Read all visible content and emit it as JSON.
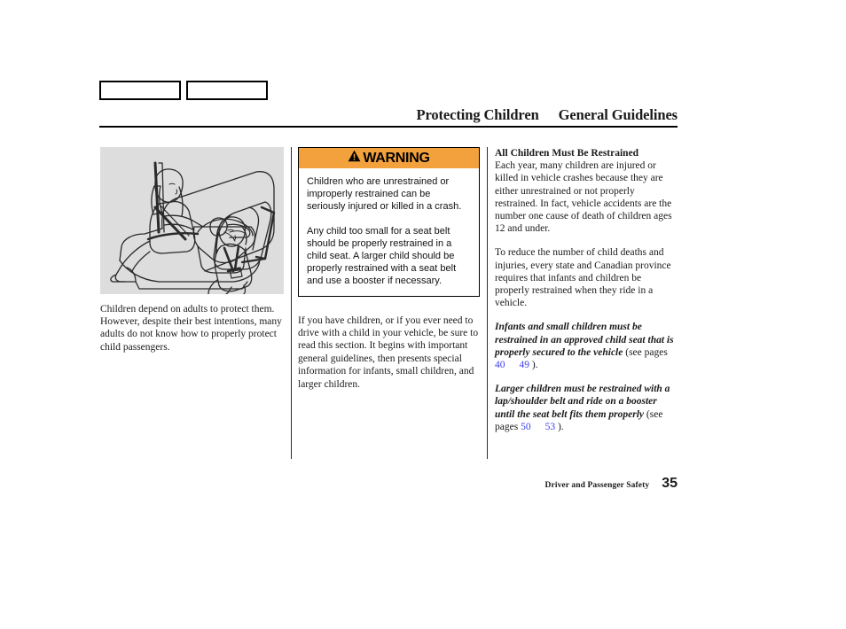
{
  "header": {
    "tabs": [
      {
        "label": ""
      },
      {
        "label": ""
      }
    ],
    "title_primary": "Protecting Children",
    "title_secondary": "General Guidelines"
  },
  "left_column": {
    "illustration_name": "rear-seat-children-restraint-illustration",
    "caption": "Children depend on adults to protect them. However, despite their best intentions, many adults do not know how to properly protect child passengers."
  },
  "middle_column": {
    "warning": {
      "icon": "warning-triangle-icon",
      "label": "WARNING",
      "header_color": "#f3a13c",
      "paragraphs": [
        "Children who are unrestrained or improperly restrained can be seriously injured or killed in a crash.",
        "Any child too small for a seat belt should be properly restrained in a child seat. A larger child should be properly restrained with a seat belt and use a booster if necessary."
      ]
    },
    "paragraph": "If you have children, or if you ever need to drive with a child in your vehicle, be sure to read this section. It begins with important general guidelines, then presents special information for infants, small children, and larger children."
  },
  "right_column": {
    "heading": "All Children Must Be Restrained",
    "paragraph_1": "Each year, many children are injured or killed in vehicle crashes because they are either unrestrained or not properly restrained. In fact, vehicle accidents are the number one cause of death of children ages 12 and under.",
    "paragraph_2": "To reduce the number of child deaths and injuries, every state and Canadian province requires that infants and children be properly restrained when they ride in a vehicle.",
    "note_1": {
      "emphasis": "Infants and small children must be restrained in an approved child seat that is properly secured to the vehicle",
      "ref_prefix": " (see pages ",
      "ref_from": "40",
      "ref_to": "49",
      "ref_suffix": " ).",
      "link_color": "#3d3df0"
    },
    "note_2": {
      "emphasis": "Larger children must be restrained with a lap/shoulder belt and ride on a booster until the seat belt fits them properly",
      "ref_prefix": " (see pages ",
      "ref_from": "50",
      "ref_to": "53",
      "ref_suffix": " ).",
      "link_color": "#3d3df0"
    }
  },
  "footer": {
    "section_label": "Driver and Passenger Safety",
    "page_number": "35"
  }
}
